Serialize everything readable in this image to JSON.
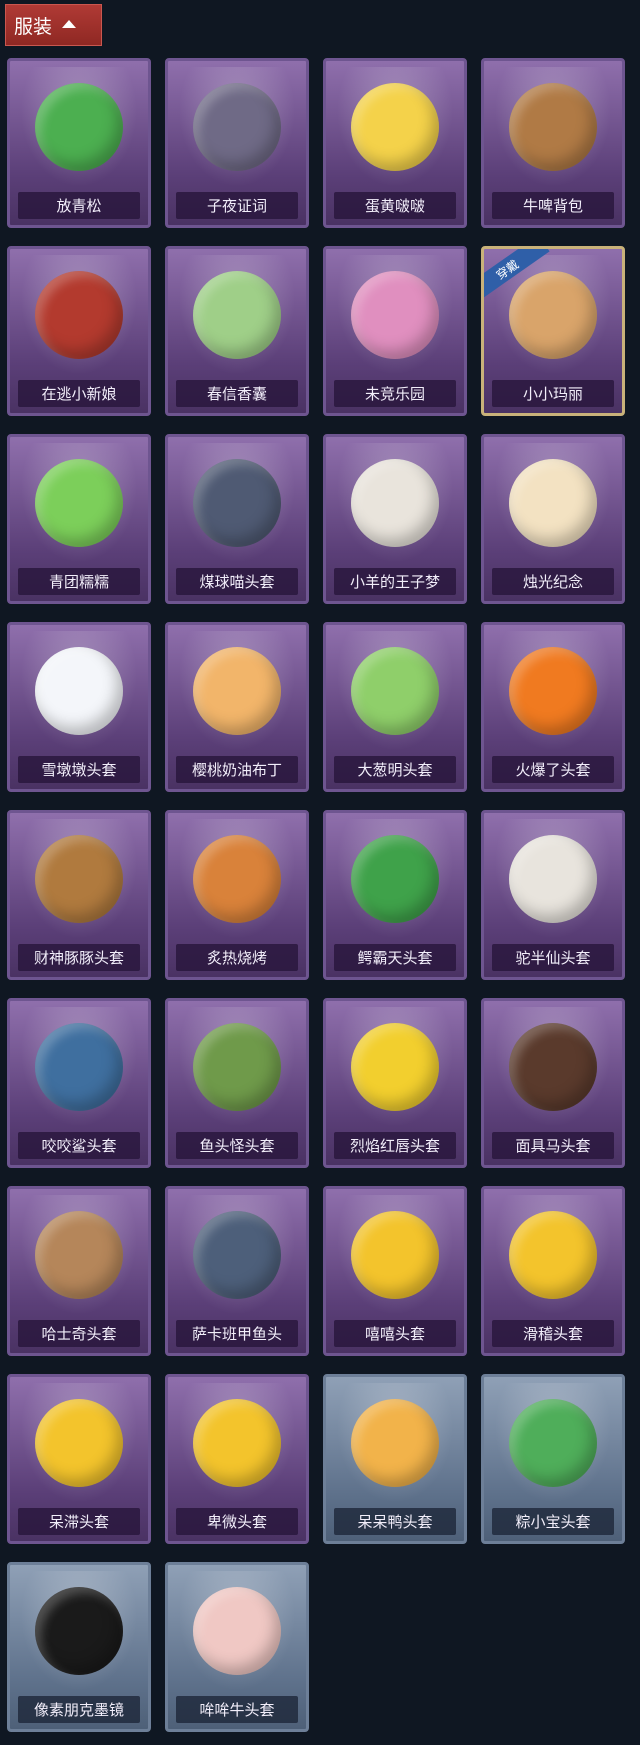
{
  "header": {
    "title": "服装"
  },
  "worn_badge": "穿戴",
  "items": [
    {
      "label": "放青松",
      "art": "tree-pot-icon",
      "color": "#4caf50",
      "tone": "purple"
    },
    {
      "label": "子夜证词",
      "art": "crow-mask-icon",
      "color": "#6f6a86",
      "tone": "purple"
    },
    {
      "label": "蛋黄啵啵",
      "art": "chick-icon",
      "color": "#f4d24a",
      "tone": "purple"
    },
    {
      "label": "牛啤背包",
      "art": "barrel-icon",
      "color": "#b07a45",
      "tone": "purple"
    },
    {
      "label": "在逃小新娘",
      "art": "lamp-icon",
      "color": "#b33a2e",
      "tone": "purple"
    },
    {
      "label": "春信香囊",
      "art": "sachet-icon",
      "color": "#9fcf88",
      "tone": "purple"
    },
    {
      "label": "未竞乐园",
      "art": "doll-icon",
      "color": "#e08fbf",
      "tone": "purple"
    },
    {
      "label": "小小玛丽",
      "art": "mary-doll-icon",
      "color": "#d9a46a",
      "tone": "purple",
      "worn": true
    },
    {
      "label": "青团糯糯",
      "art": "green-bun-icon",
      "color": "#7ccf5a",
      "tone": "purple"
    },
    {
      "label": "煤球喵头套",
      "art": "cat-head-icon",
      "color": "#4f5a73",
      "tone": "purple"
    },
    {
      "label": "小羊的王子梦",
      "art": "sheep-head-icon",
      "color": "#e9e4dc",
      "tone": "purple"
    },
    {
      "label": "烛光纪念",
      "art": "candle-icon",
      "color": "#f3e2c2",
      "tone": "purple"
    },
    {
      "label": "雪墩墩头套",
      "art": "snowman-head-icon",
      "color": "#f4f6fa",
      "tone": "purple"
    },
    {
      "label": "樱桃奶油布丁",
      "art": "pudding-icon",
      "color": "#f2b56a",
      "tone": "purple"
    },
    {
      "label": "大葱明头套",
      "art": "scallion-head-icon",
      "color": "#8fcf6a",
      "tone": "purple"
    },
    {
      "label": "火爆了头套",
      "art": "fire-head-icon",
      "color": "#f07a20",
      "tone": "purple"
    },
    {
      "label": "财神豚豚头套",
      "art": "capybara-head-icon",
      "color": "#b07a3e",
      "tone": "purple"
    },
    {
      "label": "炙热烧烤",
      "art": "bbq-head-icon",
      "color": "#d9823a",
      "tone": "purple"
    },
    {
      "label": "鳄霸天头套",
      "art": "croc-head-icon",
      "color": "#3fa24a",
      "tone": "purple"
    },
    {
      "label": "驼半仙头套",
      "art": "alpaca-head-icon",
      "color": "#e8e4dd",
      "tone": "purple"
    },
    {
      "label": "咬咬鲨头套",
      "art": "shark-head-icon",
      "color": "#3f6f9f",
      "tone": "purple"
    },
    {
      "label": "鱼头怪头套",
      "art": "fish-head-icon",
      "color": "#6f9a4a",
      "tone": "purple"
    },
    {
      "label": "烈焰红唇头套",
      "art": "pikachu-head-icon",
      "color": "#f2cf2e",
      "tone": "purple"
    },
    {
      "label": "面具马头套",
      "art": "horse-head-icon",
      "color": "#5a3a2c",
      "tone": "purple"
    },
    {
      "label": "哈士奇头套",
      "art": "dog-head-icon",
      "color": "#b5865a",
      "tone": "purple"
    },
    {
      "label": "萨卡班甲鱼头",
      "art": "fish-mask-icon",
      "color": "#4d5f7a",
      "tone": "purple"
    },
    {
      "label": "嘻嘻头套",
      "art": "grin-emoji-icon",
      "color": "#f3c42c",
      "tone": "purple"
    },
    {
      "label": "滑稽头套",
      "art": "smirk-emoji-icon",
      "color": "#f3c42c",
      "tone": "purple"
    },
    {
      "label": "呆滞头套",
      "art": "stare-emoji-icon",
      "color": "#f3c42c",
      "tone": "purple"
    },
    {
      "label": "卑微头套",
      "art": "humble-emoji-icon",
      "color": "#f3c42c",
      "tone": "purple"
    },
    {
      "label": "呆呆鸭头套",
      "art": "duck-head-icon",
      "color": "#f2b34a",
      "tone": "blue"
    },
    {
      "label": "粽小宝头套",
      "art": "zongzi-head-icon",
      "color": "#4fae5a",
      "tone": "blue"
    },
    {
      "label": "像素朋克墨镜",
      "art": "pixel-sunglasses-icon",
      "color": "#1a1a1a",
      "tone": "blue"
    },
    {
      "label": "哞哞牛头套",
      "art": "cow-head-icon",
      "color": "#f0c8c4",
      "tone": "blue"
    }
  ]
}
